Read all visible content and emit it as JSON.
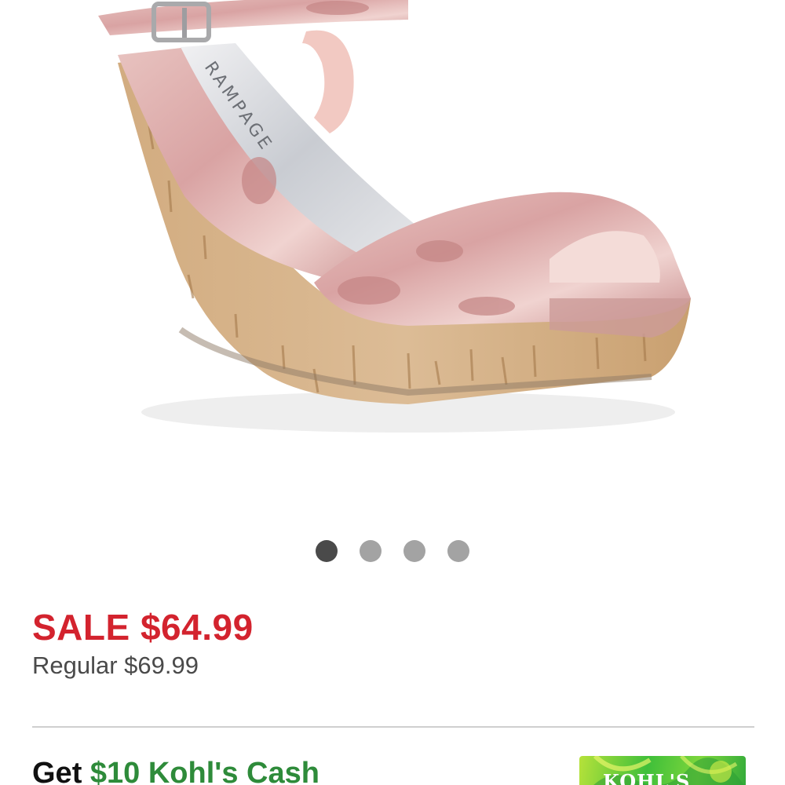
{
  "product": {
    "image_alt": "Rampage velvet cork wedge sandal",
    "insole_brand": "RAMPAGE",
    "carousel": {
      "count": 4,
      "active_index": 0
    }
  },
  "pricing": {
    "sale": "SALE $64.99",
    "regular": "Regular $69.99"
  },
  "promo": {
    "prefix": "Get ",
    "cash": "$10 Kohl's Cash",
    "card_label": "KOHL'S"
  },
  "colors": {
    "sale_red": "#d3232e",
    "cash_green": "#2e8b3a",
    "velvet_pink": "#d9a3a3",
    "cork": "#d6b48c"
  }
}
